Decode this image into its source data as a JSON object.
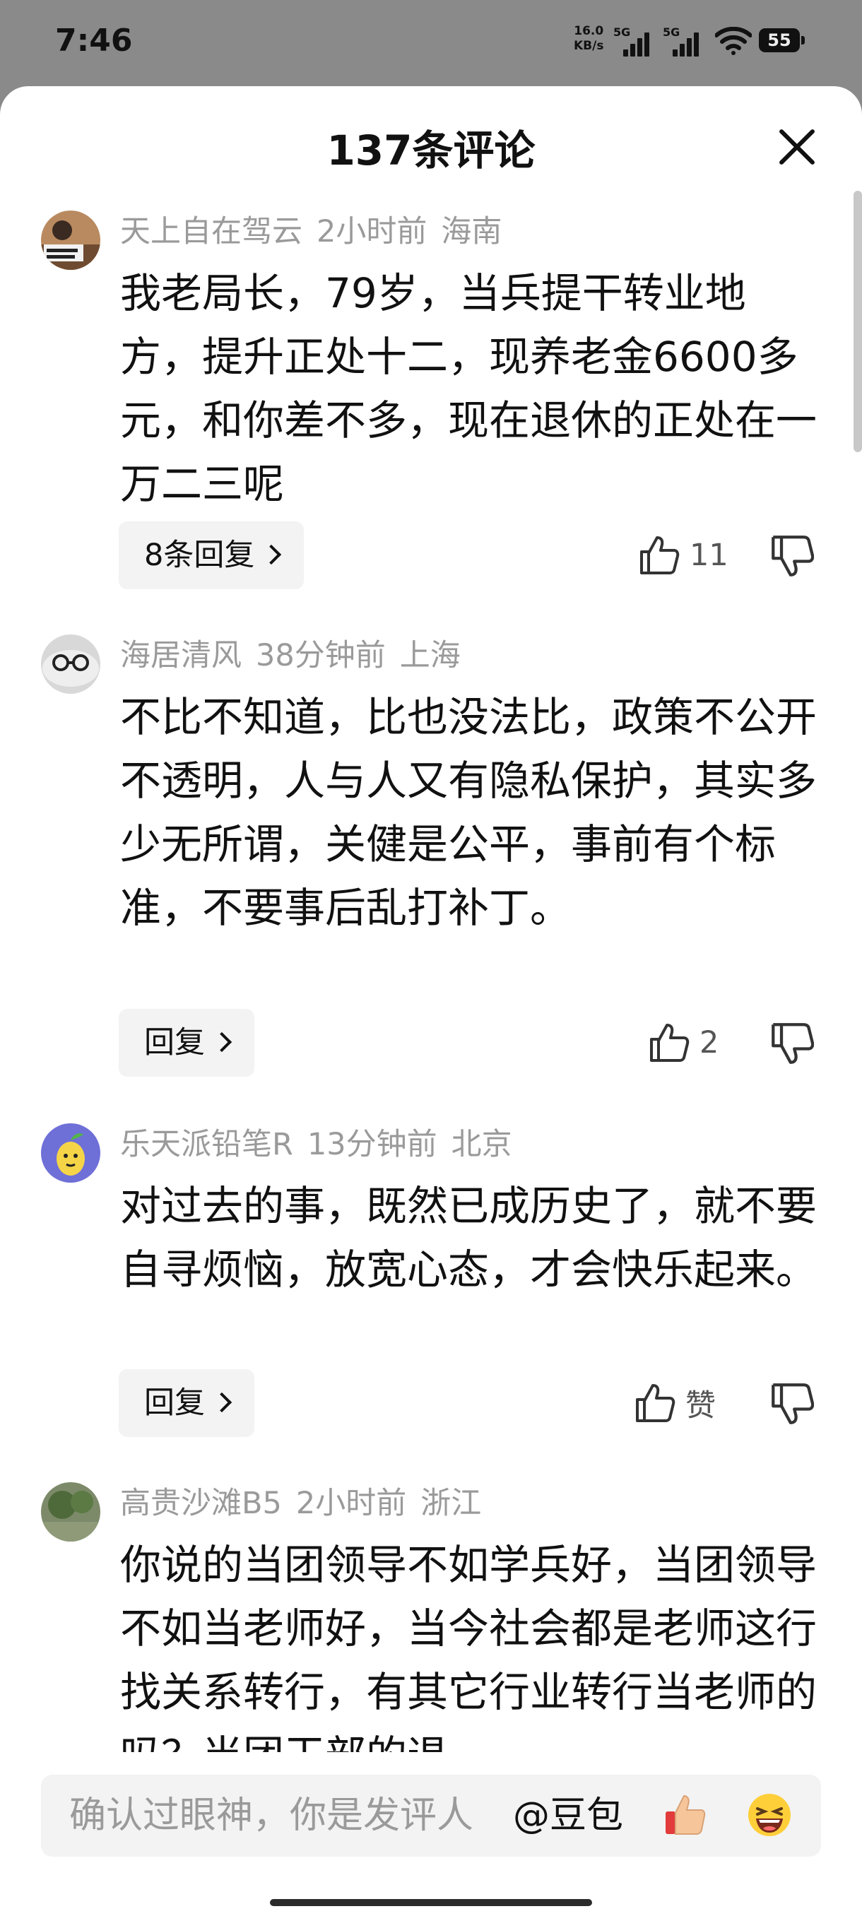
{
  "status": {
    "time": "7:46",
    "speed_value": "16.0",
    "speed_unit": "KB/s",
    "sim1": "5G",
    "sim2": "5G",
    "battery": "55"
  },
  "sheet": {
    "title": "137条评论"
  },
  "comments": [
    {
      "user": "天上自在驾云",
      "time": "2小时前",
      "location": "海南",
      "text": "我老局长，79岁，当兵提干转业地方，提升正处十二，现养老金6600多元，和你差不多，现在退休的正处在一万二三呢",
      "reply_label": "8条回复",
      "likes": "11"
    },
    {
      "user": "海居清风",
      "time": "38分钟前",
      "location": "上海",
      "text": "不比不知道，比也没法比，政策不公开不透明，人与人又有隐私保护，其实多少无所谓，关健是公平，事前有个标准，不要事后乱打补丁。",
      "reply_label": "回复",
      "likes": "2"
    },
    {
      "user": "乐天派铅笔R",
      "time": "13分钟前",
      "location": "北京",
      "text": "对过去的事，既然已成历史了，就不要自寻烦恼，放宽心态，才会快乐起来。",
      "reply_label": "回复",
      "likes": "赞"
    },
    {
      "user": "高贵沙滩B5",
      "time": "2小时前",
      "location": "浙江",
      "text": "你说的当团领导不如学兵好，当团领导不如当老师好，当今社会都是老师这行找关系转行，有其它行业转行当老师的吗？当团干部的退",
      "reply_label": "",
      "likes": ""
    }
  ],
  "input": {
    "placeholder": "确认过眼神，你是发评人",
    "mention": "@豆包"
  },
  "colors": {
    "sheet_bg": "#ffffff",
    "meta_text": "#9a9a9a",
    "overlay": "#8a8a8a"
  }
}
